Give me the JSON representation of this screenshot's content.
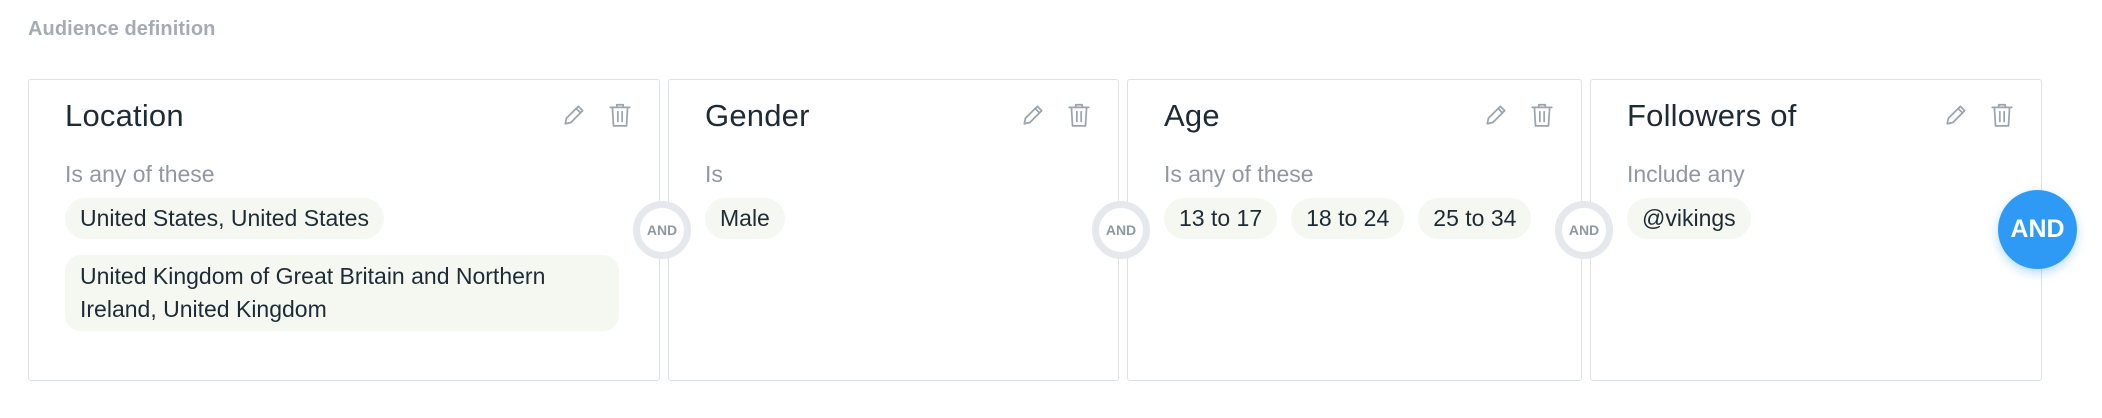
{
  "section": {
    "label": "Audience definition"
  },
  "icons": {
    "edit": "pencil-icon",
    "delete": "trash-icon",
    "color": "#9aa4ac"
  },
  "cards": [
    {
      "title": "Location",
      "qualifier": "Is any of these",
      "chips": [
        "United States, United States",
        "United Kingdom of Great Britain and Northern Ireland, United Kingdom"
      ]
    },
    {
      "title": "Gender",
      "qualifier": "Is",
      "chips": [
        "Male"
      ]
    },
    {
      "title": "Age",
      "qualifier": "Is any of these",
      "chips": [
        "13 to 17",
        "18 to 24",
        "25 to 34"
      ]
    },
    {
      "title": "Followers of",
      "qualifier": "Include any",
      "chips": [
        "@vikings"
      ]
    }
  ],
  "connectors": [
    "AND",
    "AND",
    "AND"
  ],
  "add_button": {
    "label": "AND",
    "color": "#2f9af5"
  }
}
